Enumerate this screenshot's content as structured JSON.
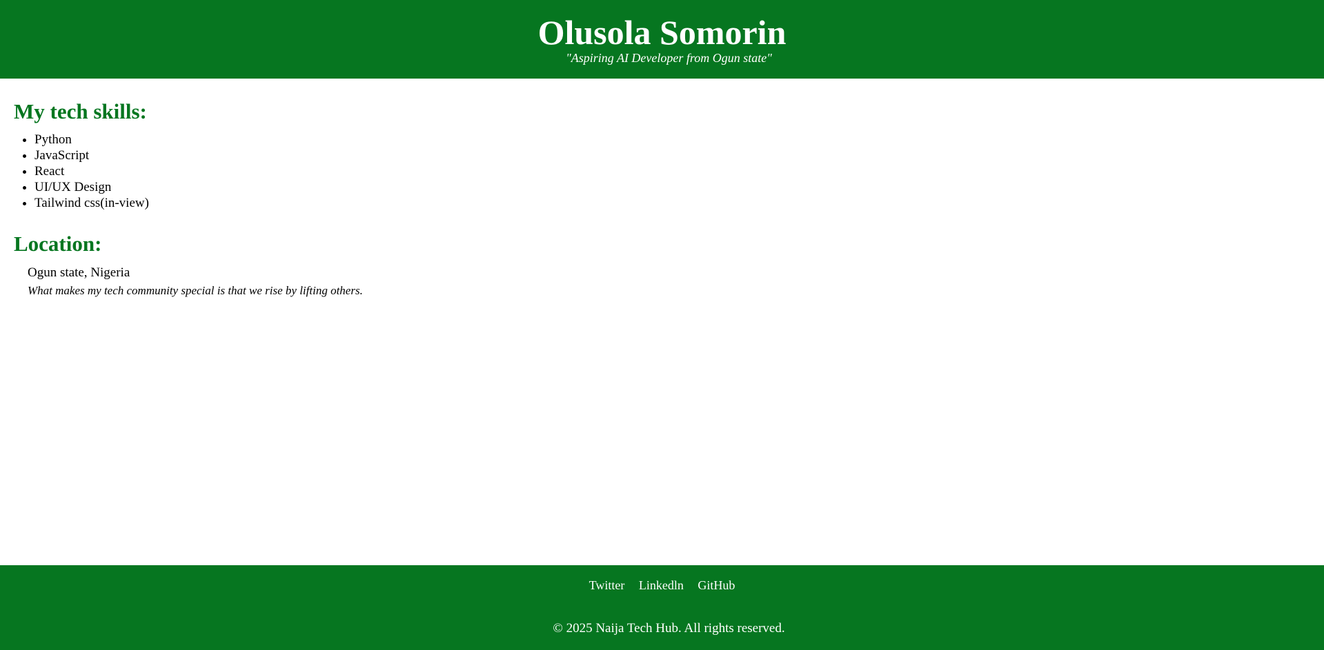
{
  "header": {
    "title": "Olusola Somorin",
    "tagline": "\"Aspiring AI Developer from Ogun state\""
  },
  "skills": {
    "heading": "My tech skills:",
    "items": [
      "Python",
      "JavaScript",
      "React",
      "UI/UX Design",
      "Tailwind css(in-view)"
    ]
  },
  "location": {
    "heading": "Location:",
    "place": "Ogun state, Nigeria",
    "quote": "What makes my tech community special is that we rise by lifting others."
  },
  "footer": {
    "links": [
      "Twitter",
      "Linkedln",
      "GitHub"
    ],
    "copyright": "© 2025 Naija Tech Hub. All rights reserved."
  },
  "colors": {
    "brand": "#067620",
    "header_text": "#ffffff"
  }
}
